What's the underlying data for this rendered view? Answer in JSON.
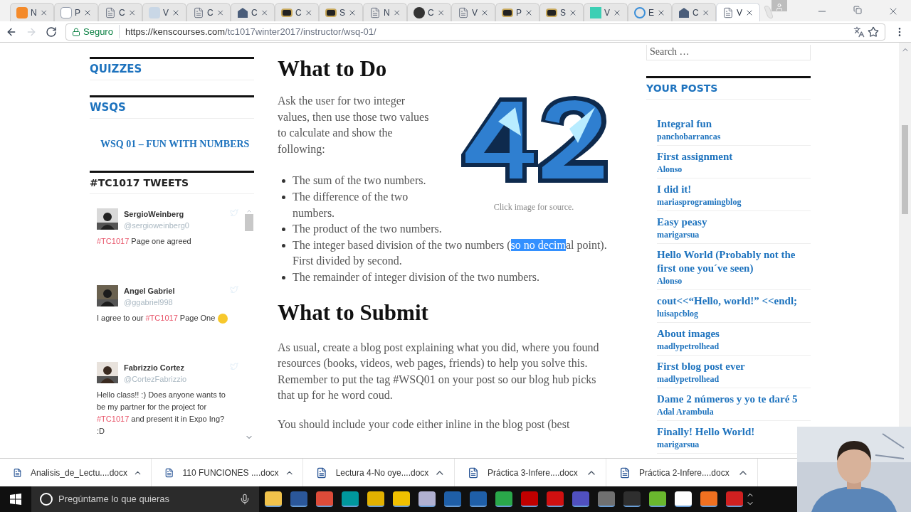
{
  "browser": {
    "tabs": [
      {
        "label": "N",
        "kind": "feed",
        "selected": false
      },
      {
        "label": "P",
        "kind": "wordpress",
        "selected": false
      },
      {
        "label": "C",
        "kind": "page",
        "selected": false
      },
      {
        "label": "V",
        "kind": "rletter",
        "selected": false
      },
      {
        "label": "C",
        "kind": "page",
        "selected": false
      },
      {
        "label": "C",
        "kind": "campus",
        "selected": false
      },
      {
        "label": "C",
        "kind": "board",
        "selected": false
      },
      {
        "label": "S",
        "kind": "board",
        "selected": false
      },
      {
        "label": "N",
        "kind": "page",
        "selected": false
      },
      {
        "label": "C",
        "kind": "circle",
        "selected": false
      },
      {
        "label": "V",
        "kind": "page",
        "selected": false
      },
      {
        "label": "P",
        "kind": "board",
        "selected": false
      },
      {
        "label": "S",
        "kind": "board",
        "selected": false
      },
      {
        "label": "V",
        "kind": "square",
        "selected": false
      },
      {
        "label": "E",
        "kind": "globe",
        "selected": false
      },
      {
        "label": "C",
        "kind": "campus",
        "selected": false
      },
      {
        "label": "V",
        "kind": "page",
        "selected": true
      }
    ],
    "secure_label": "Seguro",
    "url_host": "https://kenscourses.com",
    "url_path": "/tc1017winter2017/instructor/wsq-01/"
  },
  "left_sidebar": {
    "sections": [
      {
        "title": "QUIZZES"
      },
      {
        "title": "WSQS",
        "links": [
          "WSQ 01 – FUN WITH NUMBERS"
        ]
      }
    ],
    "tweets_title": "#TC1017 TWEETS",
    "tweets": [
      {
        "name": "SergioWeinberg",
        "handle": "@sergioweinberg0",
        "segments": [
          {
            "kind": "hashtag",
            "text": "#TC1017"
          },
          {
            "kind": "plain",
            "text": " Page one agreed"
          }
        ],
        "emoji": false
      },
      {
        "name": "Angel Gabriel",
        "handle": "@ggabriel998",
        "segments": [
          {
            "kind": "plain",
            "text": "I agree to our "
          },
          {
            "kind": "hashtag",
            "text": "#TC1017"
          },
          {
            "kind": "plain",
            "text": " Page One"
          }
        ],
        "emoji": true
      },
      {
        "name": "Fabrizzio Cortez",
        "handle": "@CortezFabrizzio",
        "segments": [
          {
            "kind": "plain",
            "text": "Hello class!! :) Does anyone wants to be my partner for the project for "
          },
          {
            "kind": "hashtag",
            "text": "#TC1017"
          },
          {
            "kind": "plain",
            "text": " and present it in Expo Ing? :D"
          }
        ],
        "emoji": false
      }
    ]
  },
  "main": {
    "heading1": "What to Do",
    "intro": "Ask the user for two integer values, then use those two values to calculate and show the following:",
    "image_caption": "Click image for source.",
    "bullets": [
      {
        "before": "The sum of the two numbers."
      },
      {
        "before": "The difference of the two numbers."
      },
      {
        "before": "The product of the two numbers."
      },
      {
        "before": "The integer based division of the two numbers (",
        "selected_text": "so no decim",
        "after": "al point). First divided by second."
      },
      {
        "before": "The remainder of integer division of the two numbers."
      }
    ],
    "heading2": "What to Submit",
    "paragraphs": [
      "As usual, create a blog post explaining what you did, where you found resources (books, videos, web pages, friends) to help you solve this. Remember to put the tag #WSQ01 on your post so our blog hub picks that up for he word coud.",
      "You should include your code either inline in the blog post (best"
    ]
  },
  "right_sidebar": {
    "search": {
      "placeholder": "Search …"
    },
    "posts_title": "YOUR POSTS",
    "posts": [
      {
        "title": "Integral fun",
        "author": "panchobarrancas"
      },
      {
        "title": "First assignment",
        "author": "Alonso"
      },
      {
        "title": "I did it!",
        "author": "mariasprogramingblog"
      },
      {
        "title": "Easy peasy",
        "author": "marigarsua"
      },
      {
        "title": "Hello World (Probably not the first one you´ve seen)",
        "author": "Alonso"
      },
      {
        "title": "cout<<“Hello, world!” <<endl;",
        "author": "luisapcblog"
      },
      {
        "title": "About images",
        "author": "madlypetrolhead"
      },
      {
        "title": "First blog post ever",
        "author": "madlypetrolhead"
      },
      {
        "title": "Dame 2 números y yo te daré 5",
        "author": "Adal Arambula"
      },
      {
        "title": "Finally! Hello World!",
        "author": "marigarsua"
      }
    ]
  },
  "downloads": [
    "Analisis_de_Lectu....docx",
    "110 FUNCIONES ....docx",
    "Lectura 4-No oye....docx",
    "Práctica 3-Infere....docx",
    "Práctica 2-Infere....docx"
  ],
  "taskbar": {
    "search_placeholder": "Pregúntame lo que quieras"
  }
}
